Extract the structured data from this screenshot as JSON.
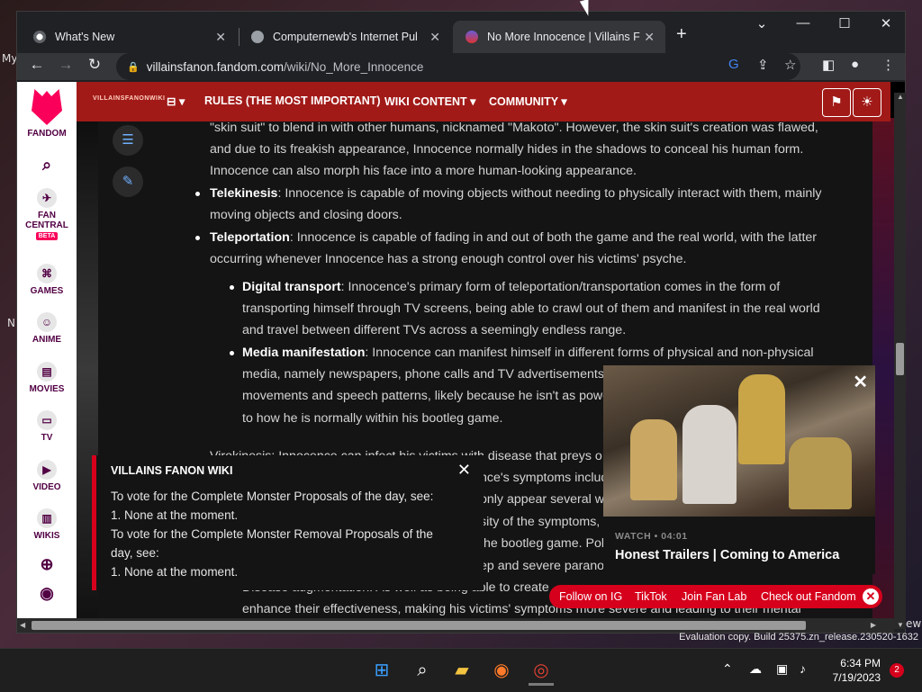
{
  "desktop": {
    "left_label_top": "My",
    "left_label_mid": "N",
    "right_label": "ew"
  },
  "browser": {
    "tabs": [
      {
        "title": "What's New"
      },
      {
        "title": "Computernewb's Internet Pub H"
      },
      {
        "title": "No More Innocence | Villains Fan"
      }
    ],
    "url_domain": "villainsfanon.fandom.com",
    "url_path": "/wiki/No_More_Innocence"
  },
  "fandom_rail": {
    "brand": "FANDOM",
    "items": [
      {
        "label": "FAN CENTRAL",
        "badge": "BETA"
      },
      {
        "label": "GAMES"
      },
      {
        "label": "ANIME"
      },
      {
        "label": "MOVIES"
      },
      {
        "label": "TV"
      },
      {
        "label": "VIDEO"
      },
      {
        "label": "WIKIS"
      }
    ]
  },
  "wiki_nav": {
    "logo_text": "VILLAINSFANONWIKI",
    "items": [
      {
        "label": "RULES (THE MOST IMPORTANT)"
      },
      {
        "label": "WIKI CONTENT"
      },
      {
        "label": "COMMUNITY"
      }
    ]
  },
  "article": {
    "lines": [
      "\"skin suit\" to blend in with other humans, nicknamed \"Makoto\". However, the skin suit's creation was flawed,",
      "and due to its freakish appearance, Innocence normally hides in the shadows to conceal his human form.",
      "Innocence can also morph his face into a more human-looking appearance."
    ],
    "telekinesis_term": "Telekinesis",
    "telekinesis_text1": ": Innocence is capable of moving objects without needing to physically interact with them, mainly",
    "telekinesis_text2": "moving objects and closing doors.",
    "teleportation_term": "Teleportation",
    "teleportation_text1": ": Innocence is capable of fading in and out of both the game and the real world, with the latter",
    "teleportation_text2": "occurring whenever Innocence has a strong enough control over his victims' psyche.",
    "digital_term": "Digital transport",
    "digital_text1": ": Innocence's primary form of teleportation/transportation comes in the form of",
    "digital_text2": "transporting himself through TV screens, being able to crawl out of them and manifest in the real world",
    "digital_text3": "and travel between different TVs across a seemingly endless range.",
    "media_term": "Media manifestation",
    "media_text1": ": Innocence can manifest himself in different forms of physical and non-physical",
    "media_text2": "media, namely newspapers, phone calls and TV advertisements, a",
    "media_text3": "movements and speech patterns, likely because he isn't as powe",
    "media_text4": "to how he is normally within his bootleg game.",
    "virokinesis_frag": "Virokinesis: Innocence can infect his victims with disease that preys o",
    "frag2": "nce's symptoms include",
    "frag3": "only appear several wee",
    "frag4": "sity of the symptoms, th",
    "frag5": "the bootleg game. Polic",
    "frag6": "ep and severe paranoia",
    "frag7": "Disease augmentation: As well as being able to create",
    "frag8": "enhance their effectiveness, making his victims' symptoms more severe and leading to their mental"
  },
  "notice": {
    "title": "VILLAINS FANON WIKI",
    "lines": [
      "To vote for the Complete Monster Proposals of the day, see:",
      "1. None at the moment.",
      "To vote for the Complete Monster Removal Proposals of the",
      "day, see:",
      "1. None at the moment."
    ]
  },
  "video": {
    "watch": "WATCH • 04:01",
    "title": "Honest Trailers | Coming to America"
  },
  "promo": {
    "items": [
      "Follow on IG",
      "TikTok",
      "Join Fan Lab",
      "Check out Fandom"
    ]
  },
  "eval_copy": "Evaluation copy. Build 25375.zn_release.230520-1632",
  "taskbar": {
    "time": "6:34 PM",
    "date": "7/19/2023",
    "notifications": "2"
  }
}
